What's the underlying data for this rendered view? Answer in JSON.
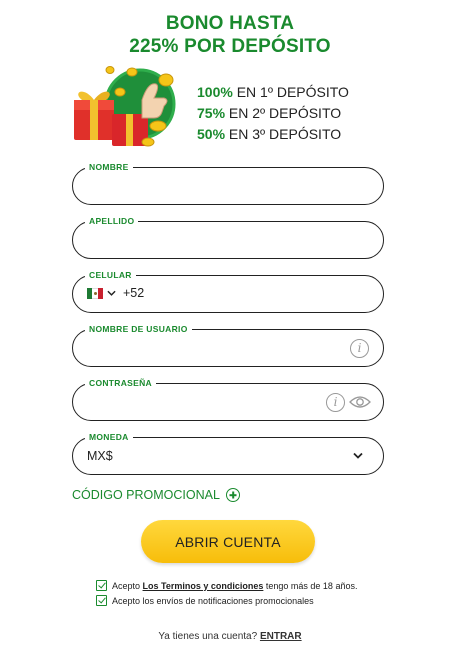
{
  "headline": {
    "line1": "BONO HASTA",
    "line2": "225% POR DEPÓSITO"
  },
  "bonuses": [
    {
      "pct": "100%",
      "text": " EN 1º DEPÓSITO"
    },
    {
      "pct": "75%",
      "text": " EN 2º DEPÓSITO"
    },
    {
      "pct": "50%",
      "text": " EN 3º DEPÓSITO"
    }
  ],
  "form": {
    "nombre": {
      "label": "NOMBRE",
      "value": ""
    },
    "apellido": {
      "label": "APELLIDO",
      "value": ""
    },
    "celular": {
      "label": "CELULAR",
      "dial_code": "+52",
      "value": ""
    },
    "usuario": {
      "label": "NOMBRE DE USUARIO",
      "value": ""
    },
    "contrasena": {
      "label": "CONTRASEÑA",
      "value": ""
    },
    "moneda": {
      "label": "MONEDA",
      "value": "MX$"
    }
  },
  "promo_code_label": "CÓDIGO PROMOCIONAL",
  "cta_label": "ABRIR CUENTA",
  "consents": {
    "terms_prefix": "Acepto ",
    "terms_link": "Los Terminos y condiciones",
    "terms_suffix": " tengo más de 18 años.",
    "notifications": "Acepto los envíos de notificaciones promocionales"
  },
  "login": {
    "prompt": "Ya tienes una cuenta? ",
    "link": "ENTRAR"
  },
  "colors": {
    "accent_green": "#1a8a2e",
    "cta_yellow": "#f7bd0a"
  },
  "icons": [
    "gift-promo-illustration",
    "mexico-flag-icon",
    "chevron-down-icon",
    "info-icon",
    "eye-icon",
    "plus-circle-icon",
    "checkbox-checked-icon"
  ]
}
